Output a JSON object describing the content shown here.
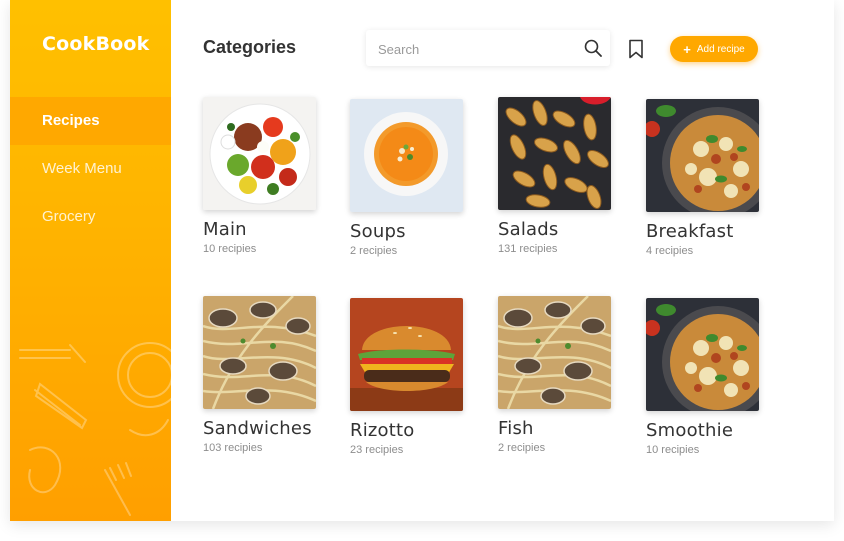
{
  "app": {
    "brand": "CookBook"
  },
  "sidebar": {
    "items": [
      {
        "label": "Recipes",
        "active": true
      },
      {
        "label": "Week Menu",
        "active": false
      },
      {
        "label": "Grocery",
        "active": false
      }
    ]
  },
  "header": {
    "title": "Categories",
    "search_placeholder": "Search",
    "add_label": "Add recipe"
  },
  "categories": [
    {
      "title": "Main",
      "count": "10 recipies",
      "image": "caprese-salad"
    },
    {
      "title": "Soups",
      "count": "2 recipies",
      "image": "tomato-soup"
    },
    {
      "title": "Salads",
      "count": "131 recipies",
      "image": "potato-wedges"
    },
    {
      "title": "Breakfast",
      "count": "4 recipies",
      "image": "skillet-pasta"
    },
    {
      "title": "Sandwiches",
      "count": "103 recipies",
      "image": "clam-linguine"
    },
    {
      "title": "Rizotto",
      "count": "23 recipies",
      "image": "burger"
    },
    {
      "title": "Fish",
      "count": "2 recipies",
      "image": "clam-linguine"
    },
    {
      "title": "Smoothie",
      "count": "10 recipies",
      "image": "skillet-pasta"
    }
  ],
  "colors": {
    "accent": "#ffa800",
    "sidebar_top": "#ffc000",
    "sidebar_bottom": "#ff9f00"
  }
}
